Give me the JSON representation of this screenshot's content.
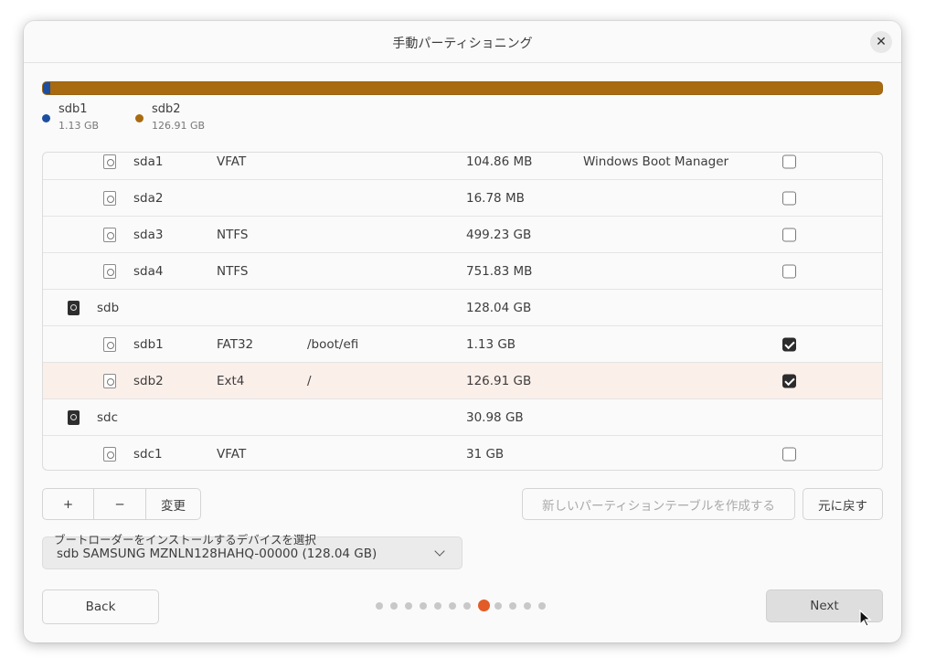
{
  "window": {
    "title": "手動パーティショニング"
  },
  "usage": {
    "segments": [
      {
        "name": "sdb1",
        "size": "1.13 GB",
        "color": "#1d4fa0",
        "fraction": 0.0088
      },
      {
        "name": "sdb2",
        "size": "126.91 GB",
        "color": "#a86b0f",
        "fraction": 0.9912
      }
    ]
  },
  "partitions": [
    {
      "type": "partition",
      "device": "sda1",
      "fs": "VFAT",
      "mount": "",
      "size": "104.86 MB",
      "system": "Windows Boot Manager",
      "format": false
    },
    {
      "type": "partition",
      "device": "sda2",
      "fs": "",
      "mount": "",
      "size": "16.78 MB",
      "system": "",
      "format": false
    },
    {
      "type": "partition",
      "device": "sda3",
      "fs": "NTFS",
      "mount": "",
      "size": "499.23 GB",
      "system": "",
      "format": false
    },
    {
      "type": "partition",
      "device": "sda4",
      "fs": "NTFS",
      "mount": "",
      "size": "751.83 MB",
      "system": "",
      "format": false
    },
    {
      "type": "disk",
      "device": "sdb",
      "fs": "",
      "mount": "",
      "size": "128.04 GB",
      "system": ""
    },
    {
      "type": "partition",
      "device": "sdb1",
      "fs": "FAT32",
      "mount": "/boot/efi",
      "size": "1.13 GB",
      "system": "",
      "format": true
    },
    {
      "type": "partition",
      "device": "sdb2",
      "fs": "Ext4",
      "mount": "/",
      "size": "126.91 GB",
      "system": "",
      "format": true,
      "selected": true
    },
    {
      "type": "disk",
      "device": "sdc",
      "fs": "",
      "mount": "",
      "size": "30.98 GB",
      "system": ""
    },
    {
      "type": "partition",
      "device": "sdc1",
      "fs": "VFAT",
      "mount": "",
      "size": "31 GB",
      "system": "",
      "format": false
    }
  ],
  "toolbar": {
    "add_label": "+",
    "remove_label": "−",
    "change_label": "変更",
    "new_table_label": "新しいパーティションテーブルを作成する",
    "revert_label": "元に戻す"
  },
  "bootloader": {
    "label": "ブートローダーをインストールするデバイスを選択",
    "selected": "sdb SAMSUNG MZNLN128HAHQ-00000 (128.04 GB)"
  },
  "nav": {
    "back_label": "Back",
    "next_label": "Next",
    "step_count": 12,
    "current_step": 8
  },
  "icons": {
    "close": "close-icon",
    "partition": "partition-icon",
    "disk": "disk-icon",
    "chevron": "chevron-down-icon",
    "cursor": "mouse-pointer-icon"
  }
}
